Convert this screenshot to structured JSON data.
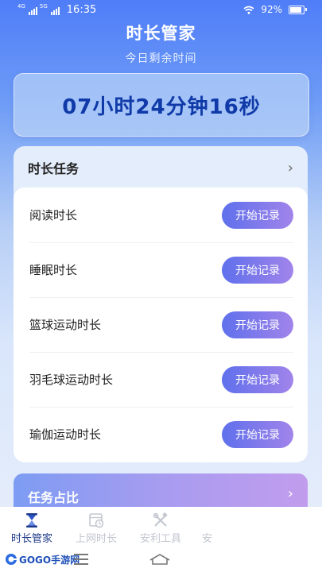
{
  "status_bar": {
    "network_1": "4G",
    "network_2": "5G",
    "time": "16:35",
    "battery": "92%",
    "battery_level": 0.92
  },
  "header": {
    "title": "时长管家",
    "subtitle": "今日剩余时间"
  },
  "timer": {
    "remaining": "07小时24分钟16秒"
  },
  "tasks": {
    "title": "时长任务",
    "chevron": "›",
    "items": [
      {
        "label": "阅读时长",
        "button": "开始记录"
      },
      {
        "label": "睡眠时长",
        "button": "开始记录"
      },
      {
        "label": "篮球运动时长",
        "button": "开始记录"
      },
      {
        "label": "羽毛球运动时长",
        "button": "开始记录"
      },
      {
        "label": "瑜伽运动时长",
        "button": "开始记录"
      }
    ]
  },
  "ratio": {
    "title": "任务占比",
    "chevron": "›"
  },
  "bottom_nav": {
    "items": [
      {
        "label": "时长管家",
        "icon": "hourglass-icon",
        "active": true
      },
      {
        "label": "上网时长",
        "icon": "clock-calendar-icon",
        "active": false
      },
      {
        "label": "安利工具",
        "icon": "tools-icon",
        "active": false
      },
      {
        "label": "安",
        "icon": "more-icon",
        "active": false
      }
    ]
  },
  "watermark": {
    "text": "GOGO手游网"
  },
  "colors": {
    "accent": "#1e3a8a",
    "timer_text": "#0f3aa8",
    "button_start": "#5f70ec",
    "button_end": "#a184ea"
  }
}
